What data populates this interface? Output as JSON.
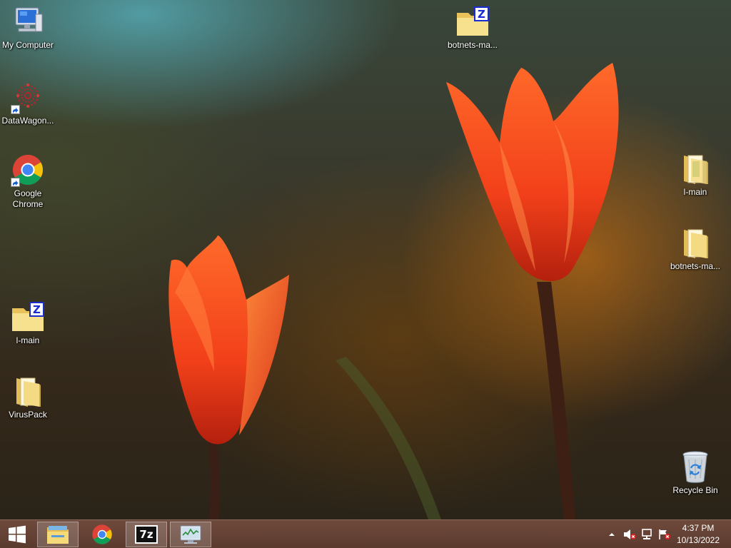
{
  "desktop": {
    "icons": {
      "my_computer": {
        "label": "My Computer",
        "icon": "computer-icon"
      },
      "datawagon": {
        "label": "DataWagon...",
        "icon": "datawagon-icon"
      },
      "google_chrome": {
        "label": "Google\nChrome",
        "icon": "chrome-icon"
      },
      "l_main_zip": {
        "label": "l-main",
        "icon": "zip-folder-icon"
      },
      "viruspack": {
        "label": "VirusPack",
        "icon": "folder-icon"
      },
      "botnets_zip": {
        "label": "botnets-ma...",
        "icon": "zip-folder-icon"
      },
      "l_main_folder": {
        "label": "l-main",
        "icon": "folder-icon"
      },
      "botnets_folder": {
        "label": "botnets-ma...",
        "icon": "folder-icon"
      },
      "recycle_bin": {
        "label": "Recycle Bin",
        "icon": "recycle-bin-icon"
      }
    }
  },
  "taskbar": {
    "start": {
      "icon": "windows-logo-icon"
    },
    "items": [
      {
        "name": "File Explorer",
        "icon": "file-explorer-icon"
      },
      {
        "name": "Google Chrome",
        "icon": "chrome-icon"
      },
      {
        "name": "7-Zip",
        "icon": "7zip-icon",
        "glyph_text": "7z"
      },
      {
        "name": "Task Manager",
        "icon": "task-manager-icon"
      }
    ],
    "tray": {
      "show_hidden": {
        "icon": "chevron-up-icon"
      },
      "volume": {
        "icon": "volume-muted-icon"
      },
      "network": {
        "icon": "network-icon"
      },
      "action_center": {
        "icon": "flag-icon"
      }
    },
    "clock": {
      "time": "4:37 PM",
      "date": "10/13/2022"
    }
  },
  "colors": {
    "taskbar": "#5b3a2e",
    "label_text": "#ffffff",
    "folder_yellow": "#f3d87a",
    "zip_badge": "#1a2ccf"
  }
}
